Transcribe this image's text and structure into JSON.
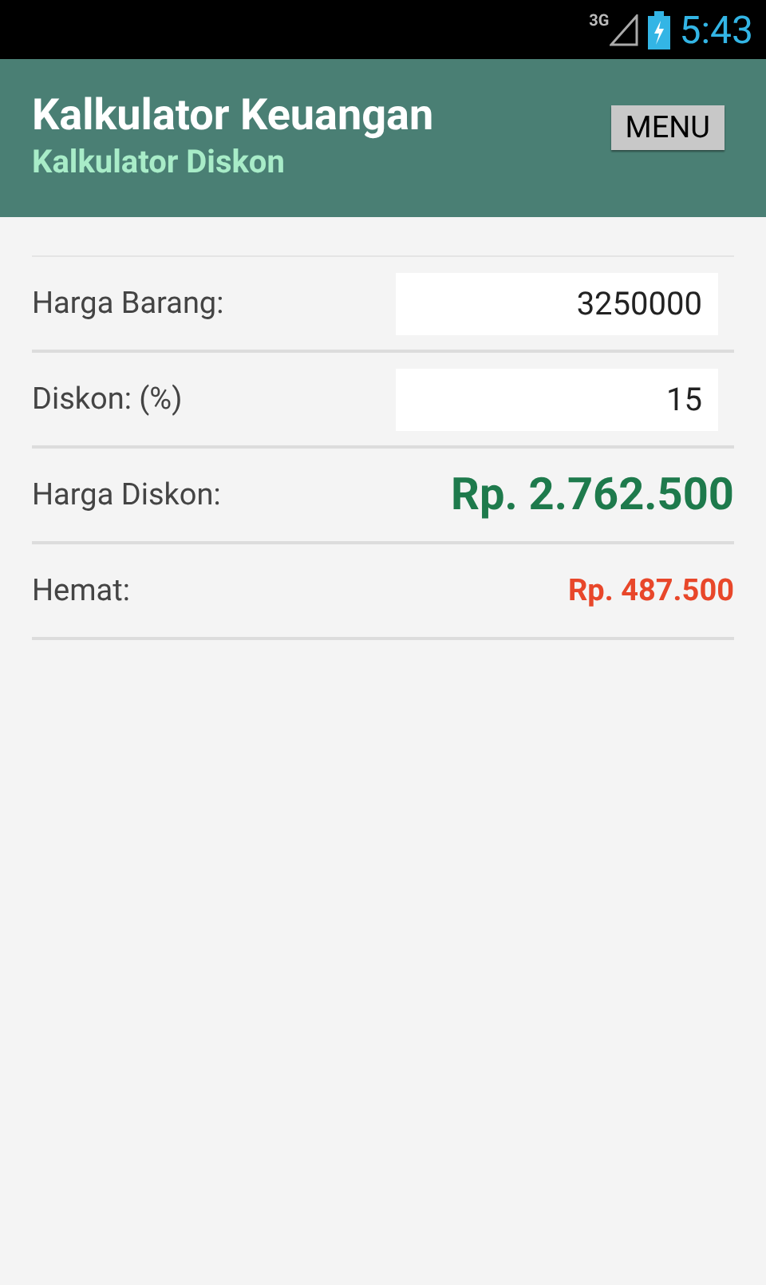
{
  "status_bar": {
    "network": "3G",
    "time": "5:43"
  },
  "header": {
    "title": "Kalkulator Keuangan",
    "subtitle": "Kalkulator Diskon",
    "menu_button": "MENU"
  },
  "rows": [
    {
      "kind": "input",
      "label": "Harga Barang:",
      "value": "3250000"
    },
    {
      "kind": "input",
      "label": "Diskon: (%)",
      "value": "15"
    },
    {
      "kind": "result",
      "label": "Harga Diskon:",
      "value": "Rp. 2.762.500",
      "large": true,
      "color": "#1e7a4c"
    },
    {
      "kind": "result",
      "label": "Hemat:",
      "value": "Rp. 487.500",
      "large": false,
      "color": "#e8472a"
    }
  ]
}
